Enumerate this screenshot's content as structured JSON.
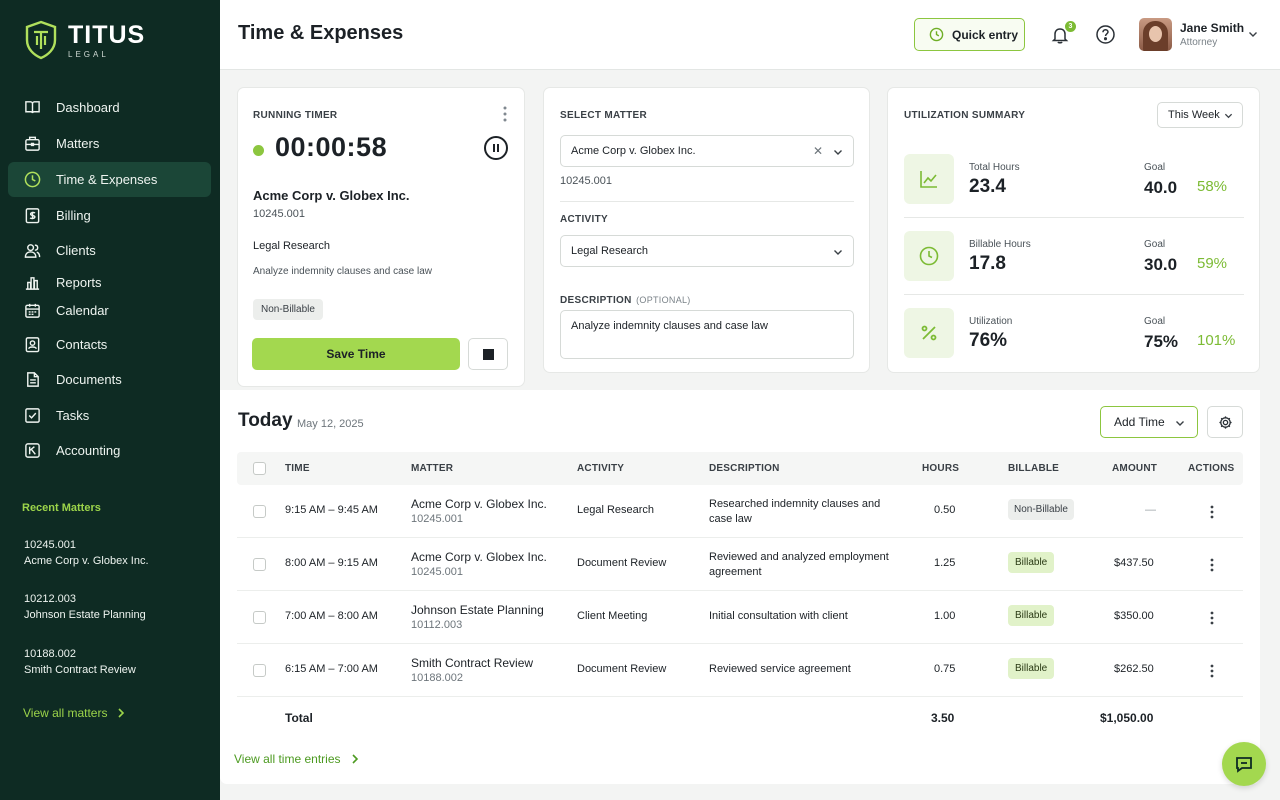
{
  "brand": {
    "name": "TITUS",
    "sub": "LEGAL"
  },
  "nav": [
    {
      "label": "Dashboard",
      "icon": "book-icon",
      "active": false
    },
    {
      "label": "Matters",
      "icon": "briefcase-icon",
      "active": false
    },
    {
      "label": "Time & Expenses",
      "icon": "clock-icon",
      "active": true
    },
    {
      "label": "Billing",
      "icon": "invoice-icon",
      "active": false
    },
    {
      "label": "Clients",
      "icon": "users-icon",
      "active": false
    },
    {
      "label": "Reports",
      "icon": "reports-icon",
      "active": false
    },
    {
      "label": "Calendar",
      "icon": "calendar-icon",
      "active": false
    },
    {
      "label": "Contacts",
      "icon": "contacts-icon",
      "active": false
    },
    {
      "label": "Documents",
      "icon": "documents-icon",
      "active": false
    },
    {
      "label": "Tasks",
      "icon": "tasks-icon",
      "active": false
    },
    {
      "label": "Accounting",
      "icon": "accounting-icon",
      "active": false
    }
  ],
  "recent": {
    "title": "Recent Matters",
    "items": [
      {
        "id": "10245.001",
        "name": "Acme Corp v. Globex Inc."
      },
      {
        "id": "10212.003",
        "name": "Johnson Estate Planning"
      },
      {
        "id": "10188.002",
        "name": "Smith Contract Review"
      }
    ],
    "view_all": "View all matters"
  },
  "header": {
    "title": "Time & Expenses",
    "quick_entry": "Quick entry",
    "notifications": "3",
    "user_name": "Jane Smith",
    "user_role": "Attorney"
  },
  "timer": {
    "label": "RUNNING TIMER",
    "time": "00:00:58",
    "matter": "Acme Corp v. Globex Inc.",
    "matter_id": "10245.001",
    "activity": "Legal Research",
    "description": "Analyze indemnity clauses and case law",
    "billable_tag": "Non-Billable",
    "save_label": "Save Time"
  },
  "matter_form": {
    "select_label": "SELECT MATTER",
    "matter_value": "Acme Corp v. Globex Inc.",
    "matter_id": "10245.001",
    "activity_label": "ACTIVITY",
    "activity_value": "Legal Research",
    "description_label": "DESCRIPTION",
    "description_optional": "(OPTIONAL)",
    "description_value": "Analyze indemnity clauses and case law"
  },
  "utilization": {
    "label": "UTILIZATION SUMMARY",
    "period": "This Week",
    "goal_label": "Goal",
    "rows": [
      {
        "name": "Total Hours",
        "value": "23.4",
        "goal": "40.0",
        "pct": "58%",
        "icon": "trend-icon"
      },
      {
        "name": "Billable Hours",
        "value": "17.8",
        "goal": "30.0",
        "pct": "59%",
        "icon": "clock-icon"
      },
      {
        "name": "Utilization",
        "value": "76%",
        "goal": "75%",
        "pct": "101%",
        "icon": "percent-icon"
      }
    ]
  },
  "today": {
    "title": "Today",
    "date": "May 12, 2025",
    "add_time": "Add Time",
    "columns": {
      "time": "TIME",
      "matter": "MATTER",
      "activity": "ACTIVITY",
      "description": "DESCRIPTION",
      "hours": "HOURS",
      "billable": "BILLABLE",
      "amount": "AMOUNT",
      "actions": "ACTIONS"
    },
    "rows": [
      {
        "time": "9:15 AM – 9:45 AM",
        "matter": "Acme Corp v. Globex Inc.",
        "matter_id": "10245.001",
        "activity": "Legal Research",
        "description": "Researched indemnity clauses and case law",
        "hours": "0.50",
        "billable": "Non-Billable",
        "amount": "—"
      },
      {
        "time": "8:00 AM – 9:15 AM",
        "matter": "Acme Corp v. Globex Inc.",
        "matter_id": "10245.001",
        "activity": "Document Review",
        "description": "Reviewed and analyzed employment agreement",
        "hours": "1.25",
        "billable": "Billable",
        "amount": "$437.50"
      },
      {
        "time": "7:00 AM – 8:00 AM",
        "matter": "Johnson Estate Planning",
        "matter_id": "10112.003",
        "activity": "Client Meeting",
        "description": "Initial consultation with client",
        "hours": "1.00",
        "billable": "Billable",
        "amount": "$350.00"
      },
      {
        "time": "6:15 AM – 7:00 AM",
        "matter": "Smith Contract Review",
        "matter_id": "10188.002",
        "activity": "Document Review",
        "description": "Reviewed service agreement",
        "hours": "0.75",
        "billable": "Billable",
        "amount": "$262.50"
      }
    ],
    "total_label": "Total",
    "total_hours": "3.50",
    "total_amount": "$1,050.00",
    "view_all": "View all time entries"
  },
  "colors": {
    "sidebar": "#0e2b23",
    "accent": "#a3d84f",
    "accent_text": "#7cbb34"
  }
}
